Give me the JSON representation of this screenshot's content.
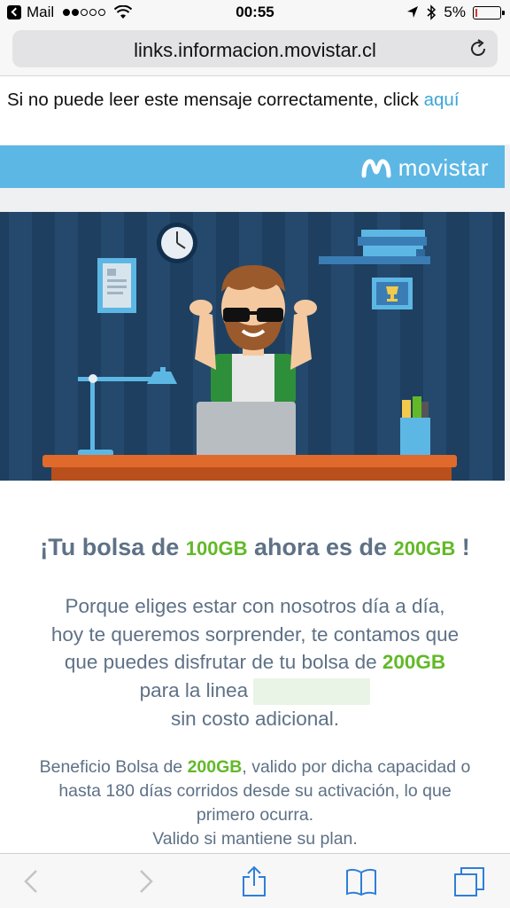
{
  "status_bar": {
    "app_back_label": "Mail",
    "time": "00:55",
    "battery": "5%",
    "signal_bars_filled": 2,
    "signal_bars_total": 5
  },
  "browser": {
    "url": "links.informacion.movistar.cl"
  },
  "email": {
    "preheader_text": "Si no puede leer este mensaje correctamente, click ",
    "preheader_link": "aquí",
    "brand_name": "movistar",
    "headline": {
      "part1": "¡Tu bolsa de ",
      "gb_old": "100GB",
      "part2": " ahora es de ",
      "gb_new": "200GB",
      "part3": " !"
    },
    "paragraph": {
      "line1": "Porque eliges estar con nosotros día a día,",
      "line2": "hoy te queremos sorprender, te contamos que",
      "line3_text": "que puedes disfrutar de tu bolsa de ",
      "line3_gb": "200GB",
      "line4_text": "para la linea ",
      "line5": "sin costo adicional."
    },
    "benefit": {
      "prefix": "Beneficio Bolsa de ",
      "gb": "200GB",
      "line1_suffix": ", valido por dicha capacidad o",
      "line2": "hasta 180 días corridos desde su activación, lo que",
      "line3": "primero ocurra.",
      "line4": "Valido si mantiene su plan."
    }
  },
  "colors": {
    "brand_blue": "#5db7e4",
    "link_blue": "#3aa6d8",
    "text_slate": "#5e7186",
    "gb_green": "#62b928",
    "hero_background": "#1e3f60"
  },
  "icons": {
    "back": "chevron-left-icon",
    "forward": "chevron-right-icon",
    "share": "share-icon",
    "bookmarks": "book-icon",
    "tabs": "tabs-icon",
    "reload": "reload-icon",
    "location": "location-arrow-icon",
    "bluetooth": "bluetooth-icon"
  }
}
